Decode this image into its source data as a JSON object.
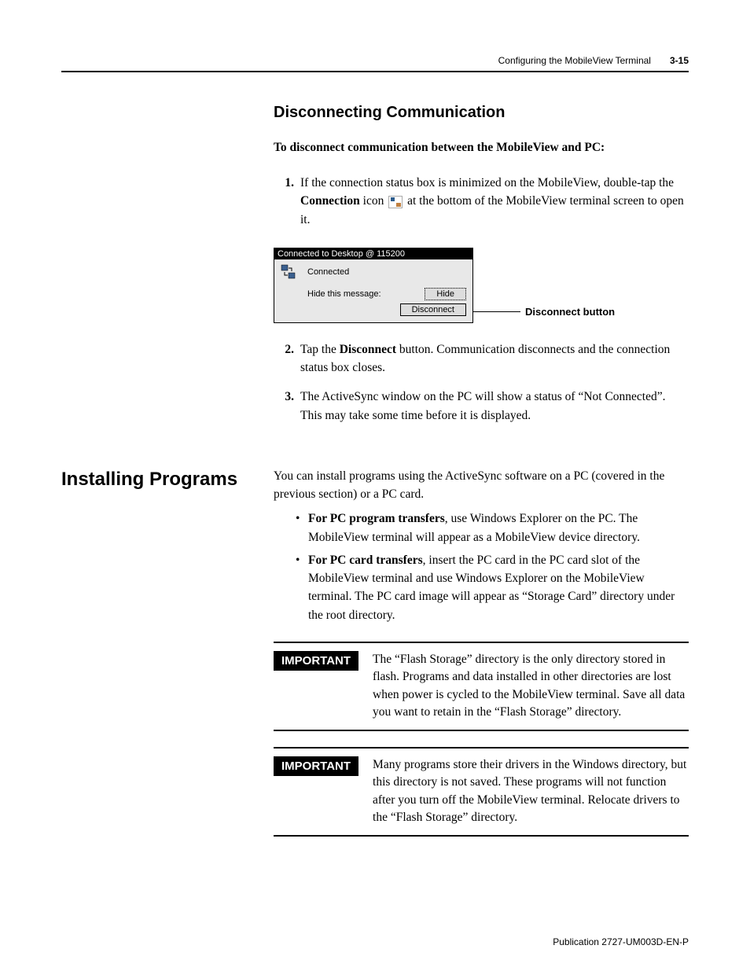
{
  "header": {
    "title": "Configuring the MobileView Terminal",
    "page": "3-15"
  },
  "s1": {
    "heading": "Disconnecting Communication",
    "intro": "To disconnect communication between the MobileView and PC:",
    "step1_a": "If the connection status box is minimized on the MobileView, double-tap the ",
    "step1_bold": "Connection",
    "step1_b": " icon ",
    "step1_c": " at the bottom of the MobileView terminal screen to open it.",
    "step2_a": "Tap the ",
    "step2_bold": "Disconnect",
    "step2_b": " button. Communication disconnects and the connection status box closes.",
    "step3": "The ActiveSync window on the PC will show a status of “Not Connected”. This may take some time before it is displayed."
  },
  "conn": {
    "title": "Connected to Desktop @ 115200",
    "status": "Connected",
    "hide_label": "Hide this message:",
    "hide_btn": "Hide",
    "disc_btn": "Disconnect",
    "callout": "Disconnect button"
  },
  "s2": {
    "heading": "Installing Programs",
    "intro": "You can install programs using the ActiveSync software on a PC (covered in the previous section) or a PC card.",
    "b1_bold": "For PC program transfers",
    "b1_rest": ", use Windows Explorer on the PC. The MobileView terminal will appear as a MobileView device directory.",
    "b2_bold": "For PC card transfers",
    "b2_rest": ", insert the PC card in the PC card slot of the MobileView terminal and use Windows Explorer on the MobileView terminal. The PC card image will appear as “Storage Card” directory under the root directory.",
    "imp_label": "IMPORTANT",
    "imp1": "The “Flash Storage” directory is the only directory stored in flash. Programs and data installed in other directories are lost when power is cycled to the MobileView terminal. Save all data you want to retain in the “Flash Storage” directory.",
    "imp2": "Many programs store their drivers in the Windows directory, but this directory is not saved. These programs will not function after you turn off the MobileView terminal. Relocate drivers to the “Flash Storage” directory."
  },
  "footer": "Publication 2727-UM003D-EN-P"
}
